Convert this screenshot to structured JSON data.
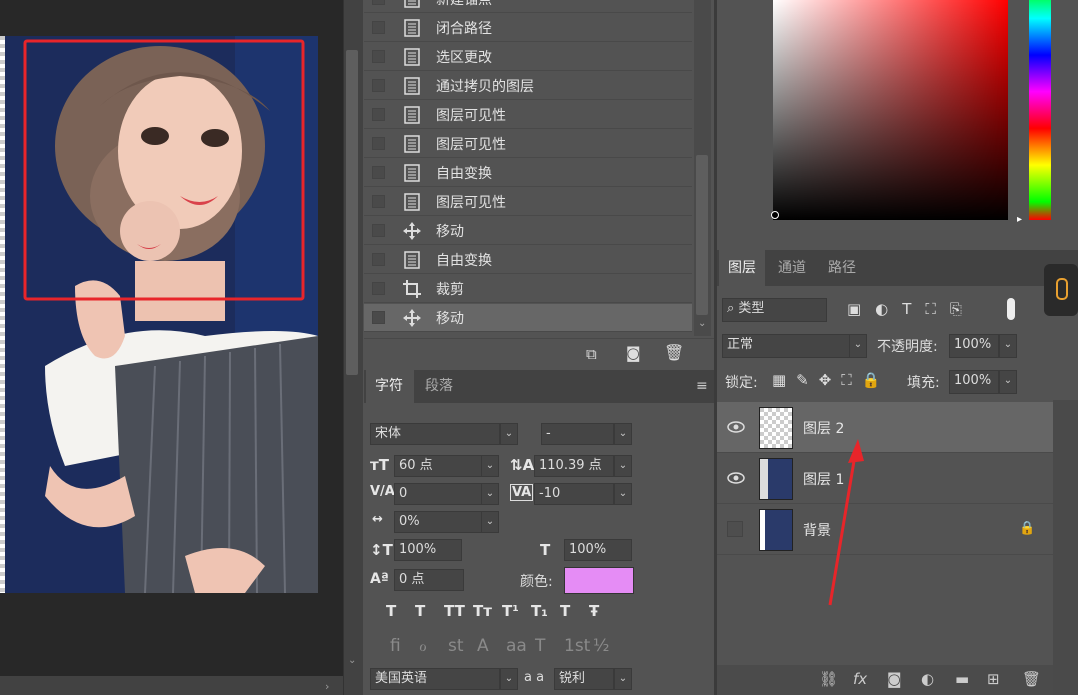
{
  "history": {
    "items": [
      {
        "label": "新建锚点",
        "icon": "document-icon"
      },
      {
        "label": "闭合路径",
        "icon": "document-icon"
      },
      {
        "label": "选区更改",
        "icon": "document-icon"
      },
      {
        "label": "通过拷贝的图层",
        "icon": "document-icon"
      },
      {
        "label": "图层可见性",
        "icon": "document-icon"
      },
      {
        "label": "图层可见性",
        "icon": "document-icon"
      },
      {
        "label": "自由变换",
        "icon": "document-icon"
      },
      {
        "label": "图层可见性",
        "icon": "document-icon"
      },
      {
        "label": "移动",
        "icon": "move-icon"
      },
      {
        "label": "自由变换",
        "icon": "document-icon"
      },
      {
        "label": "裁剪",
        "icon": "crop-icon"
      },
      {
        "label": "移动",
        "icon": "move-icon"
      }
    ]
  },
  "character": {
    "tab_char": "字符",
    "tab_para": "段落",
    "font_family": "宋体",
    "font_style": "-",
    "font_size": "60 点",
    "leading": "110.39 点",
    "kerning": "0",
    "tracking": "-10",
    "scale_shift": "0%",
    "vertical_scale": "100%",
    "horizontal_scale": "100%",
    "baseline_shift": "0 点",
    "color_label": "颜色:",
    "text_color": "#e58cf5",
    "language": "美国英语",
    "aa_label": "a a",
    "antialias": "锐利",
    "style_buttons": [
      "T",
      "T",
      "TT",
      "Tт",
      "T¹",
      "T₁",
      "T",
      "Ŧ"
    ],
    "opentype_buttons": [
      "fi",
      "ℴ",
      "st",
      "A",
      "aa",
      "T",
      "1st",
      "½"
    ]
  },
  "layers": {
    "tab_layers": "图层",
    "tab_channels": "通道",
    "tab_paths": "路径",
    "filter_kind": "类型",
    "blend_mode": "正常",
    "opacity_label": "不透明度:",
    "opacity": "100%",
    "lock_label": "锁定:",
    "fill_label": "填充:",
    "fill": "100%",
    "items": [
      {
        "name": "图层 2",
        "visible": true,
        "selected": true
      },
      {
        "name": "图层 1",
        "visible": true,
        "selected": false
      },
      {
        "name": "背景",
        "visible": false,
        "selected": false,
        "locked": true
      }
    ]
  },
  "colors": {
    "selection_box": "#e8252a",
    "annotation_arrow": "#e8252a"
  }
}
